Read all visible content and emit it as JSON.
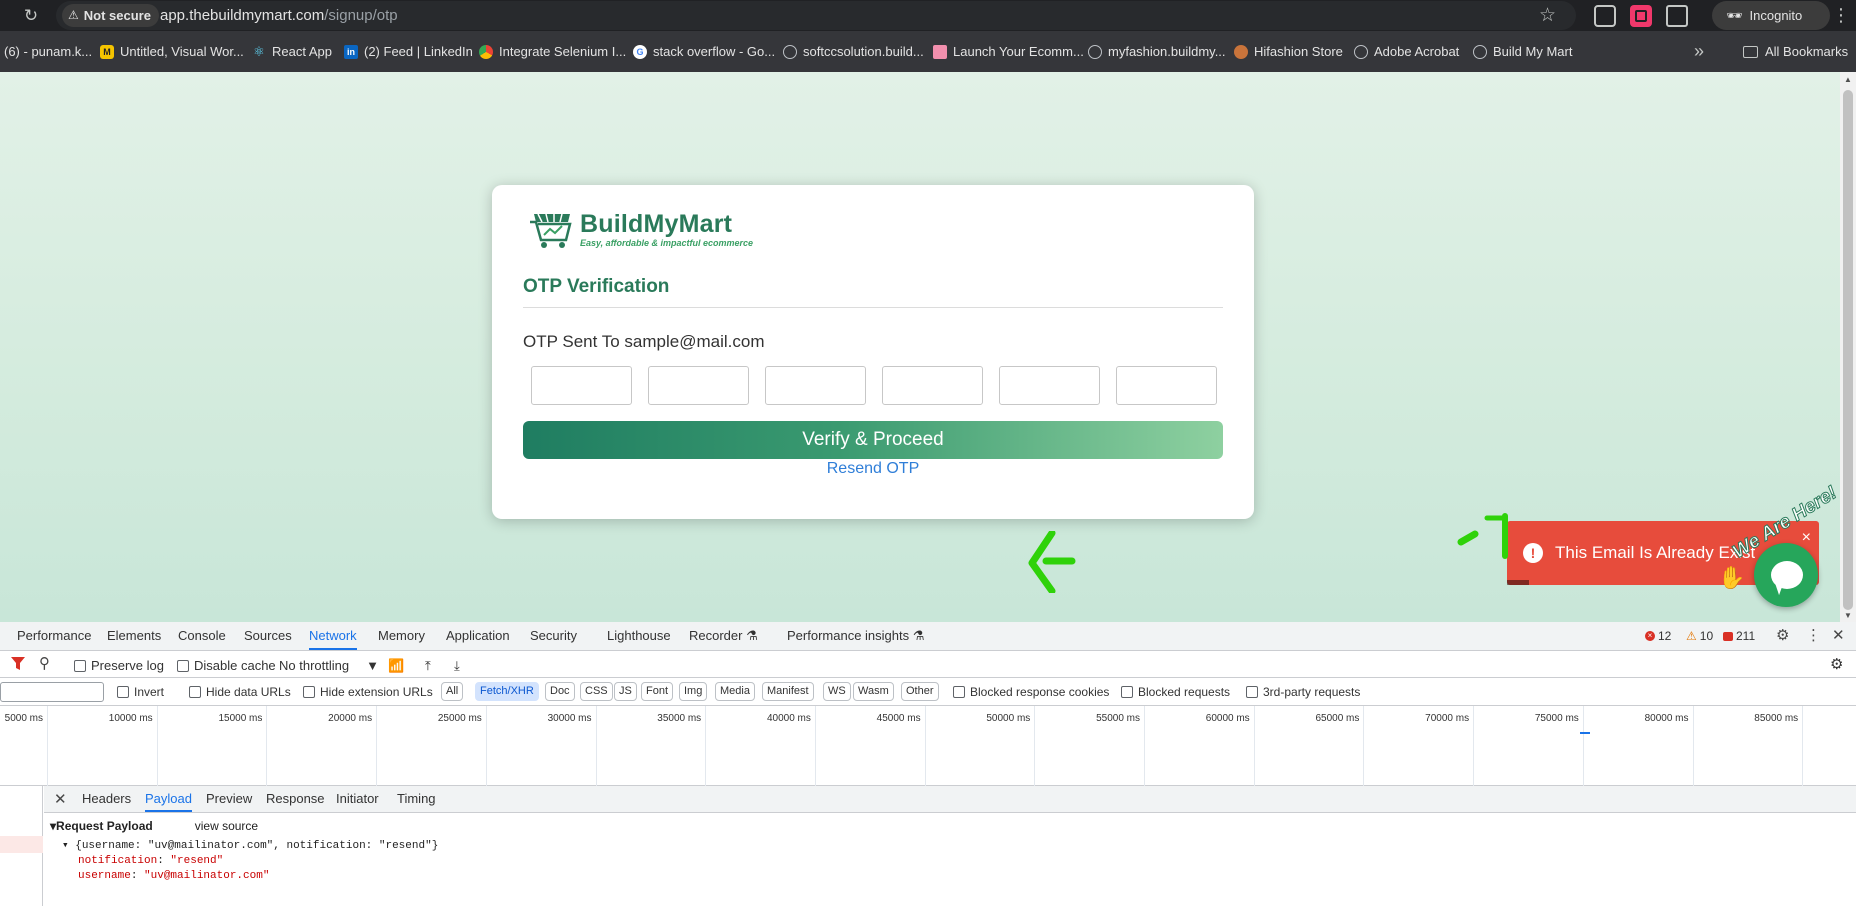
{
  "browser": {
    "security_label": "Not secure",
    "url_host": "app.thebuildmymart.com",
    "url_path": "/signup/otp",
    "incognito_label": "Incognito",
    "bookmarks": [
      {
        "label": "(6) - punam.k...",
        "icon": "globe"
      },
      {
        "label": "Untitled, Visual Wor...",
        "icon": "miro"
      },
      {
        "label": "React App",
        "icon": "react"
      },
      {
        "label": "(2) Feed | LinkedIn",
        "icon": "linkedin"
      },
      {
        "label": "Integrate Selenium I...",
        "icon": "chrome"
      },
      {
        "label": "stack overflow - Go...",
        "icon": "google"
      },
      {
        "label": "softccsolution.build...",
        "icon": "globe"
      },
      {
        "label": "Launch Your Ecomm...",
        "icon": "store"
      },
      {
        "label": "myfashion.buildmy...",
        "icon": "globe"
      },
      {
        "label": "Hifashion Store",
        "icon": "person"
      },
      {
        "label": "Adobe Acrobat",
        "icon": "globe"
      },
      {
        "label": "Build My Mart",
        "icon": "globe"
      }
    ],
    "all_bookmarks_label": "All Bookmarks"
  },
  "page": {
    "brand_name": "BuildMyMart",
    "brand_tagline": "Easy, affordable & impactful ecommerce",
    "title": "OTP Verification",
    "otp_sent_text": "OTP Sent To sample@mail.com",
    "otp_fields": [
      "",
      "",
      "",
      "",
      "",
      ""
    ],
    "verify_label": "Verify & Proceed",
    "resend_label": "Resend OTP",
    "toast_message": "This Email Is Already Exists",
    "toast_close": "×",
    "chat_label": "We Are Here!",
    "colors": {
      "brand": "#2a7a5a",
      "toast": "#e74c3c",
      "link": "#2f7ed8"
    }
  },
  "devtools": {
    "tabs": [
      "Performance",
      "Elements",
      "Console",
      "Sources",
      "Network",
      "Memory",
      "Application",
      "Security",
      "Lighthouse",
      "Recorder",
      "Performance insights"
    ],
    "active_tab": "Network",
    "errors": "12",
    "warnings": "10",
    "issues": "211",
    "toolbar": {
      "preserve_log": "Preserve log",
      "disable_cache": "Disable cache",
      "throttling": "No throttling"
    },
    "filters": {
      "invert": "Invert",
      "hide_data_urls": "Hide data URLs",
      "hide_extension_urls": "Hide extension URLs",
      "types": [
        "All",
        "Fetch/XHR",
        "Doc",
        "CSS",
        "JS",
        "Font",
        "Img",
        "Media",
        "Manifest",
        "WS",
        "Wasm",
        "Other"
      ],
      "active_type": "Fetch/XHR",
      "blocked_cookies": "Blocked response cookies",
      "blocked_requests": "Blocked requests",
      "third_party": "3rd-party requests"
    },
    "timeline_ticks": [
      "5000 ms",
      "10000 ms",
      "15000 ms",
      "20000 ms",
      "25000 ms",
      "30000 ms",
      "35000 ms",
      "40000 ms",
      "45000 ms",
      "50000 ms",
      "55000 ms",
      "60000 ms",
      "65000 ms",
      "70000 ms",
      "75000 ms",
      "80000 ms",
      "85000 ms"
    ],
    "detail_tabs": [
      "Headers",
      "Payload",
      "Preview",
      "Response",
      "Initiator",
      "Timing"
    ],
    "active_detail_tab": "Payload",
    "payload": {
      "heading": "Request Payload",
      "view_source": "view source",
      "summary": "{username: \"uv@mailinator.com\", notification: \"resend\"}",
      "notification_key": "notification",
      "notification_value": "\"resend\"",
      "username_key": "username",
      "username_value": "\"uv@mailinator.com\""
    }
  }
}
